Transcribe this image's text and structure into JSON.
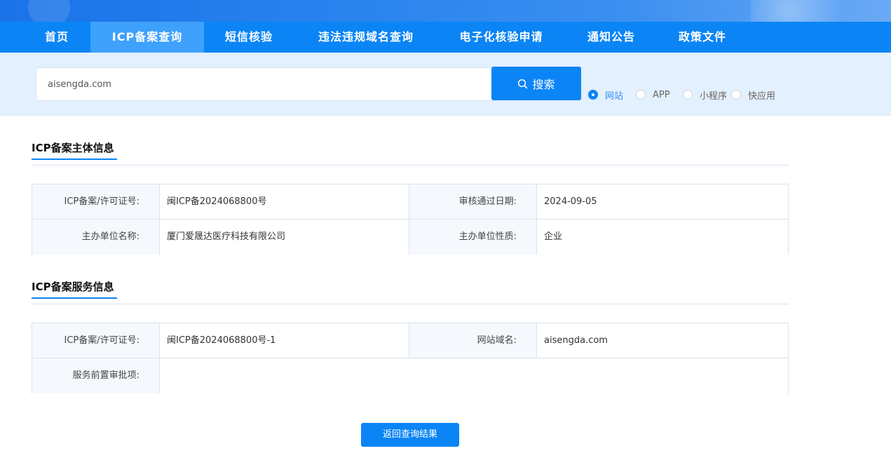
{
  "nav": {
    "items": [
      {
        "label": "首页"
      },
      {
        "label": "ICP备案查询"
      },
      {
        "label": "短信核验"
      },
      {
        "label": "违法违规域名查询"
      },
      {
        "label": "电子化核验申请"
      },
      {
        "label": "通知公告"
      },
      {
        "label": "政策文件"
      }
    ],
    "active": "ICP备案查询"
  },
  "search": {
    "value": "aisengda.com",
    "button_label": "搜索",
    "options": [
      {
        "label": "网站",
        "checked": true
      },
      {
        "label": "APP",
        "checked": false
      },
      {
        "label": "小程序",
        "checked": false
      },
      {
        "label": "快应用",
        "checked": false
      }
    ]
  },
  "subject_section": {
    "title": "ICP备案主体信息",
    "rows": [
      {
        "label1": "ICP备案/许可证号:",
        "value1": "闽ICP备2024068800号",
        "label2": "审核通过日期:",
        "value2": "2024-09-05"
      },
      {
        "label1": "主办单位名称:",
        "value1": "厦门爱晟达医疗科技有限公司",
        "label2": "主办单位性质:",
        "value2": "企业"
      }
    ]
  },
  "service_section": {
    "title": "ICP备案服务信息",
    "rows": [
      {
        "label1": "ICP备案/许可证号:",
        "value1": "闽ICP备2024068800号-1",
        "label2": "网站域名:",
        "value2": "aisengda.com"
      },
      {
        "label1": "服务前置审批项:",
        "value1": ""
      }
    ]
  },
  "back_button_label": "返回查询结果",
  "colors": {
    "primary": "#0b85f5",
    "nav_active": "#3ea1fb",
    "search_bg": "#e3f0fd"
  }
}
